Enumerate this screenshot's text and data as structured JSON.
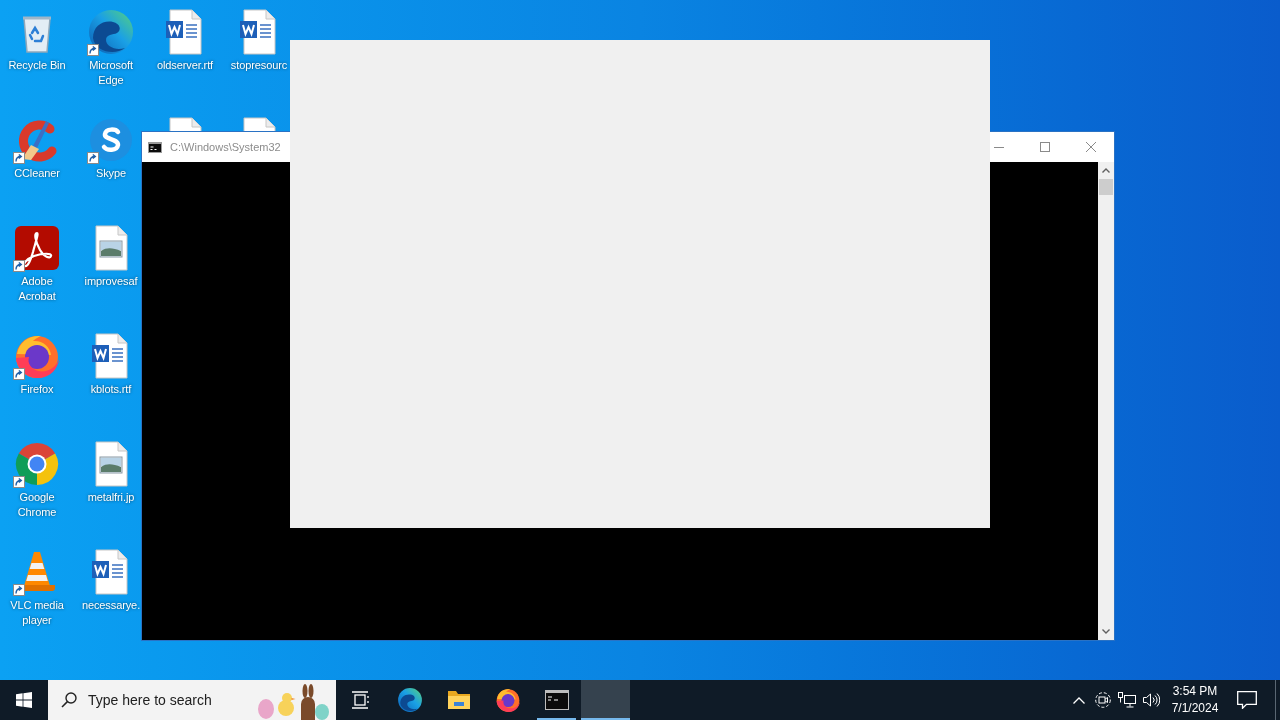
{
  "desktop": {
    "columns": [
      [
        {
          "kind": "recycle-bin",
          "label": "Recycle Bin",
          "shortcut": false
        },
        {
          "kind": "ccleaner",
          "label": "CCleaner",
          "shortcut": true
        },
        {
          "kind": "acrobat",
          "label": "Adobe Acrobat",
          "shortcut": true
        },
        {
          "kind": "firefox",
          "label": "Firefox",
          "shortcut": true
        },
        {
          "kind": "chrome",
          "label": "Google Chrome",
          "shortcut": true
        },
        {
          "kind": "vlc",
          "label": "VLC media player",
          "shortcut": true
        }
      ],
      [
        {
          "kind": "edge",
          "label": "Microsoft Edge",
          "shortcut": true
        },
        {
          "kind": "skype",
          "label": "Skype",
          "shortcut": true
        },
        {
          "kind": "image-file",
          "label": "improvesaf",
          "shortcut": false
        },
        {
          "kind": "word-file",
          "label": "kblots.rtf",
          "shortcut": false
        },
        {
          "kind": "image-file",
          "label": "metalfri.jp",
          "shortcut": false
        },
        {
          "kind": "word-file",
          "label": "necessarye.",
          "shortcut": false
        }
      ],
      [
        {
          "kind": "word-file",
          "label": "oldserver.rtf",
          "shortcut": false
        },
        {
          "kind": "file"
        }
      ],
      [
        {
          "kind": "word-file",
          "label": "stopresourc",
          "shortcut": false
        },
        {
          "kind": "file"
        }
      ]
    ]
  },
  "windows": [
    {
      "kind": "console",
      "title": "C:\\Windows\\System32"
    },
    {
      "kind": "blank"
    }
  ],
  "taskbar": {
    "search": {
      "placeholder": "Type here to search"
    },
    "buttons": [
      {
        "kind": "task-view",
        "running": false,
        "selected": false
      },
      {
        "kind": "edge",
        "running": false,
        "selected": false
      },
      {
        "kind": "explorer",
        "running": false,
        "selected": false
      },
      {
        "kind": "firefox",
        "running": false,
        "selected": false
      },
      {
        "kind": "console",
        "running": true,
        "selected": false
      },
      {
        "kind": "blank",
        "running": true,
        "selected": true
      }
    ],
    "clock": {
      "time": "3:54 PM",
      "date": "7/1/2024"
    }
  }
}
